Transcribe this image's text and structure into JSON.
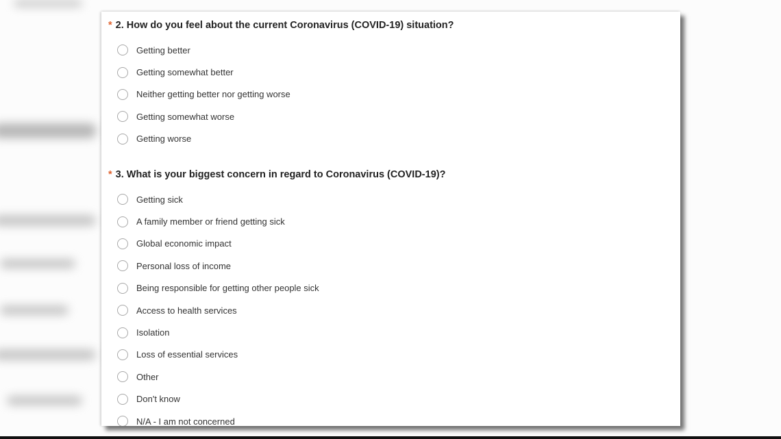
{
  "survey": {
    "questions": [
      {
        "required_marker": "*",
        "title": "2. How do you feel about the current Coronavirus (COVID-19) situation?",
        "options": [
          "Getting better",
          "Getting somewhat better",
          "Neither getting better nor getting worse",
          "Getting somewhat worse",
          "Getting worse"
        ]
      },
      {
        "required_marker": "*",
        "title": "3. What is your biggest concern in regard to Coronavirus (COVID-19)?",
        "options": [
          "Getting sick",
          "A family member or friend getting sick",
          "Global economic impact",
          "Personal loss of income",
          "Being responsible for getting other people sick",
          "Access to health services",
          "Isolation",
          "Loss of essential services",
          "Other",
          "Don't know",
          "N/A - I am not concerned"
        ]
      }
    ]
  },
  "colors": {
    "required_marker": "#e0622e",
    "question_text": "#222222",
    "option_text": "#333333",
    "radio_border": "#a8a8a8"
  }
}
